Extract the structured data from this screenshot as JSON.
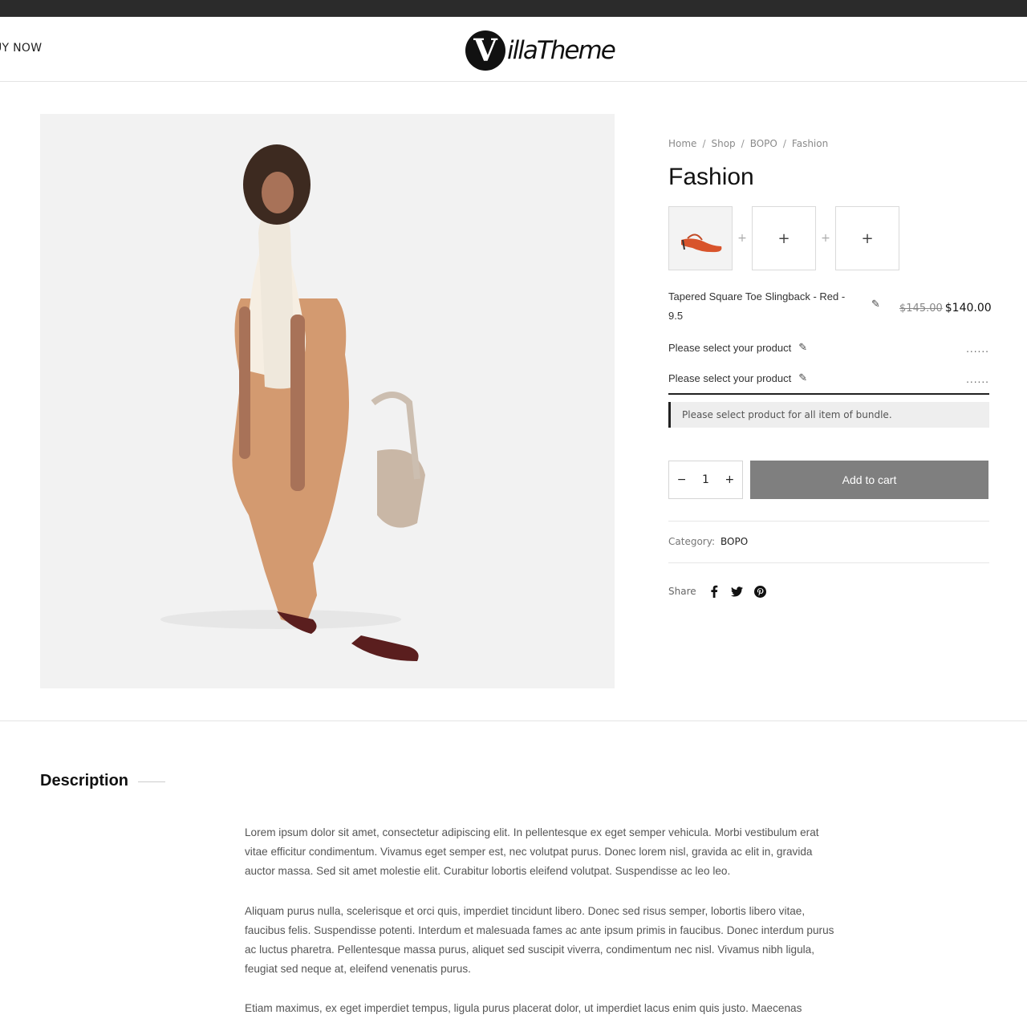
{
  "header": {
    "buy_now_label": "UY NOW",
    "logo_mark": "V",
    "logo_text": "illaTheme"
  },
  "breadcrumb": [
    "Home",
    "Shop",
    "BOPO",
    "Fashion"
  ],
  "product": {
    "title": "Fashion",
    "bundle_slot_add_glyph": "+",
    "bundle_separator_glyph": "+",
    "item1_name": "Tapered Square Toe Slingback - Red - 9.5",
    "item1_price_old": "$145.00",
    "item1_price_new": "$140.00",
    "item2_label": "Please select your product",
    "item3_label": "Please select your product",
    "placeholder_dots": "......",
    "notice": "Please select product for all item of bundle.",
    "quantity": "1",
    "qty_minus": "−",
    "qty_plus": "+",
    "add_to_cart_label": "Add to cart",
    "category_label": "Category:",
    "category_value": "BOPO",
    "share_label": "Share"
  },
  "icons": {
    "edit": "pencil-icon",
    "facebook": "facebook-icon",
    "twitter": "twitter-icon",
    "pinterest": "pinterest-icon"
  },
  "description": {
    "heading": "Description",
    "paragraphs": [
      "Lorem ipsum dolor sit amet, consectetur adipiscing elit. In pellentesque ex eget semper vehicula. Morbi vestibulum erat vitae efficitur condimentum. Vivamus eget semper est, nec volutpat purus. Donec lorem nisl, gravida ac elit in, gravida auctor massa. Sed sit amet molestie elit. Curabitur lobortis eleifend volutpat. Suspendisse ac leo leo.",
      "Aliquam purus nulla, scelerisque et orci quis, imperdiet tincidunt libero. Donec sed risus semper, lobortis libero vitae, faucibus felis. Suspendisse potenti. Interdum et malesuada fames ac ante ipsum primis in faucibus. Donec interdum purus ac luctus pharetra. Pellentesque massa purus, aliquet sed suscipit viverra, condimentum nec nisl. Vivamus nibh ligula, feugiat sed neque at, eleifend venenatis purus.",
      "Etiam maximus, ex eget imperdiet tempus, ligula purus placerat dolor, ut imperdiet lacus enim quis justo. Maecenas"
    ]
  }
}
